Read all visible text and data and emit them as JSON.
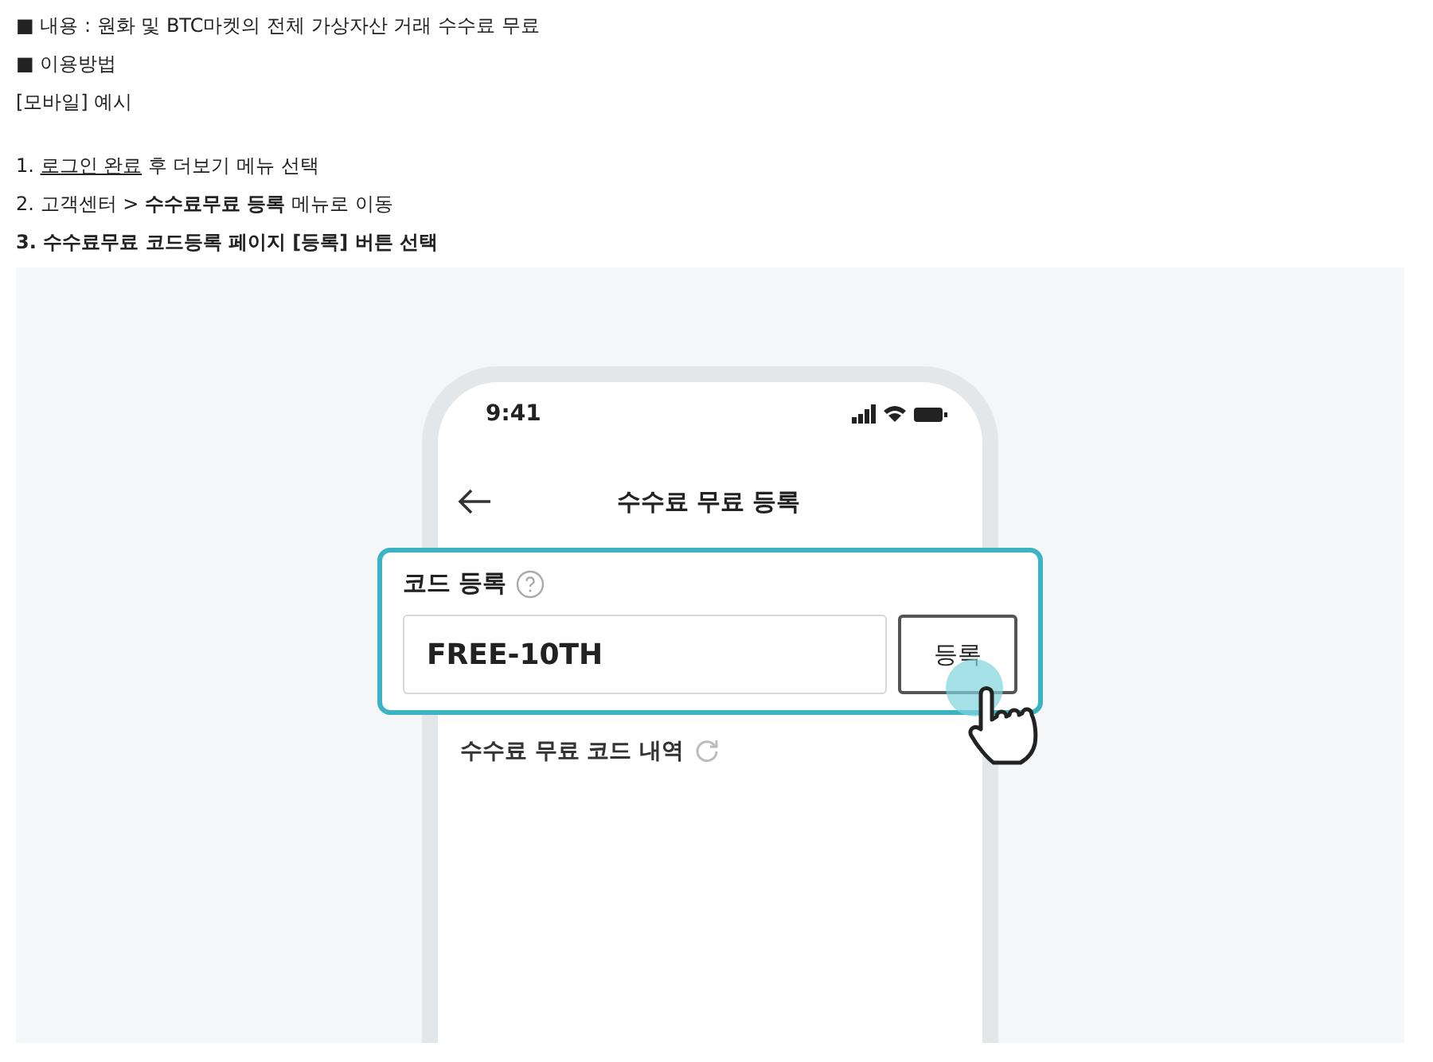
{
  "intro": [
    {
      "text": "■ 내용 : 원화 및 BTC마켓의 전체 가상자산 거래 수수료 무료"
    },
    {
      "text": "■ 이용방법"
    },
    {
      "text": "[모바일] 예시"
    }
  ],
  "steps": [
    {
      "kind": "link",
      "prefix": "1. ",
      "link": "로그인 완료",
      "text": " 후 더보기 메뉴 선택"
    },
    {
      "kind": "plain",
      "text": "2. 고객센터 > **수수료무료 등록** 메뉴로 이동"
    },
    {
      "kind": "bold",
      "text": "3. 수수료무료 코드등록 페이지 [등록] 버튼 선택"
    }
  ],
  "phone": {
    "time": "9:41",
    "title": "수수료 무료 등록",
    "card_label": "코드 등록",
    "code_value": "FREE-10TH",
    "register_button": "등록",
    "history_label": "수수료 무료 코드 내역"
  }
}
